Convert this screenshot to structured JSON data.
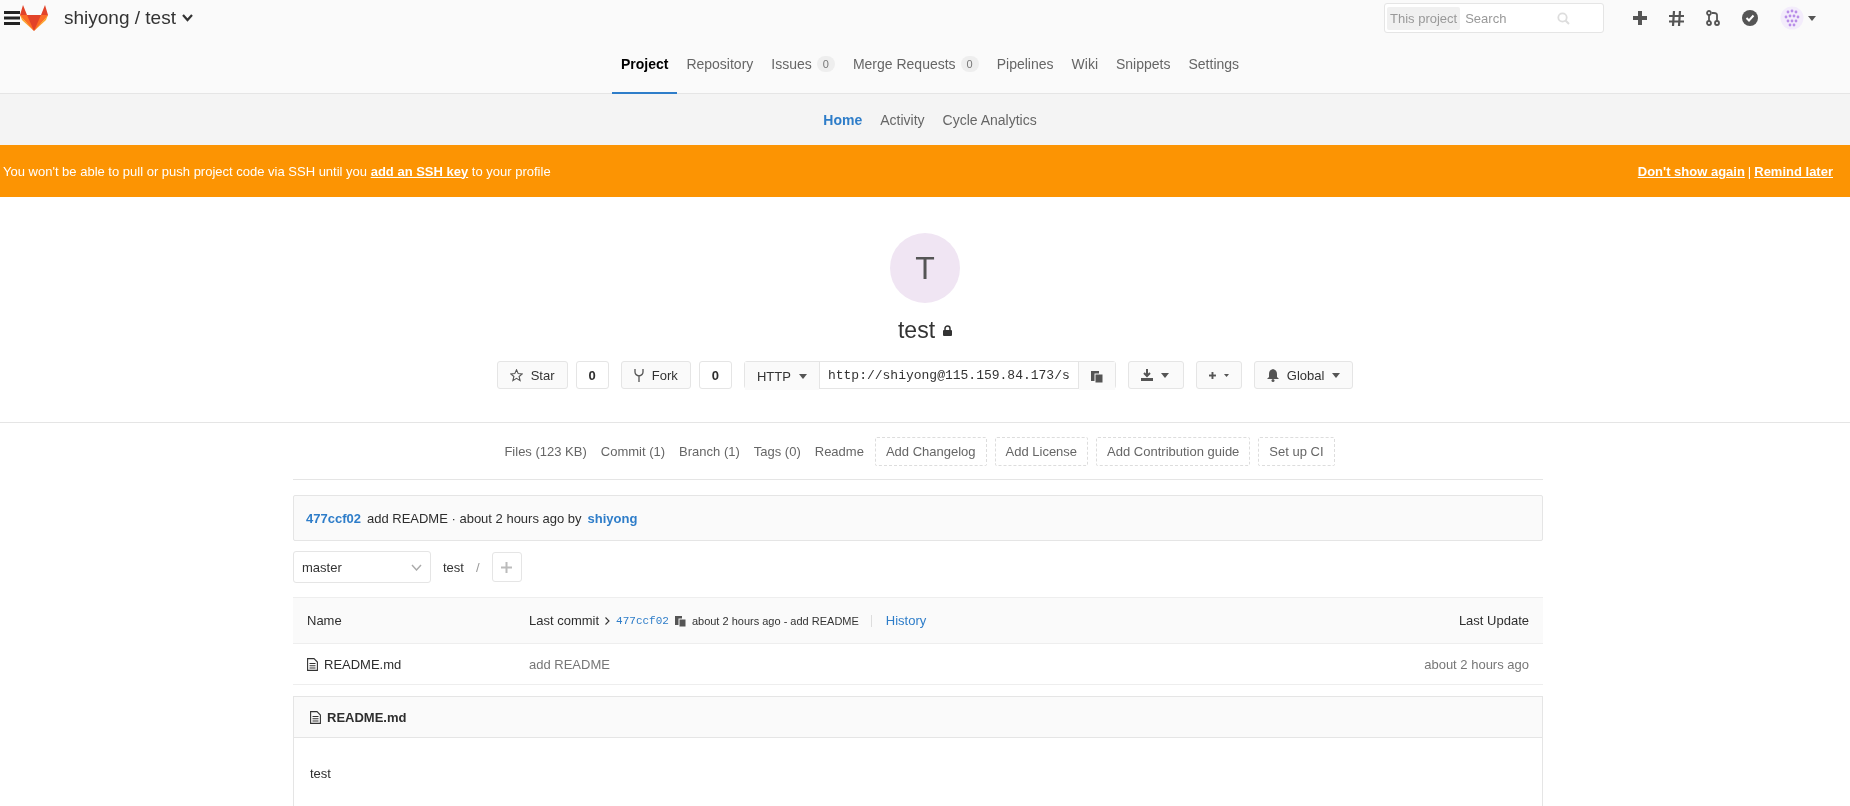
{
  "header": {
    "project_path": "shiyong / test",
    "search": {
      "scope": "This project",
      "placeholder": "Search"
    }
  },
  "nav_tabs": [
    {
      "label": "Project",
      "selected": true
    },
    {
      "label": "Repository",
      "selected": false
    },
    {
      "label": "Issues",
      "count": "0",
      "selected": false
    },
    {
      "label": "Merge Requests",
      "count": "0",
      "selected": false
    },
    {
      "label": "Pipelines",
      "selected": false
    },
    {
      "label": "Wiki",
      "selected": false
    },
    {
      "label": "Snippets",
      "selected": false
    },
    {
      "label": "Settings",
      "selected": false
    }
  ],
  "sub_tabs": [
    {
      "label": "Home",
      "selected": true
    },
    {
      "label": "Activity",
      "selected": false
    },
    {
      "label": "Cycle Analytics",
      "selected": false
    }
  ],
  "banner": {
    "text_before": "You won't be able to pull or push project code via SSH until you",
    "link": "add an SSH key",
    "text_after": "to your profile",
    "actions": [
      "Don't show again",
      "Remind later"
    ],
    "separator": "|"
  },
  "project": {
    "avatar_letter": "T",
    "name": "test",
    "private": true,
    "star": {
      "label": "Star",
      "count": "0"
    },
    "fork": {
      "label": "Fork",
      "count": "0"
    },
    "clone": {
      "protocol": "HTTP",
      "url": "http://shiyong@115.159.84.173/s"
    },
    "notification": "Global"
  },
  "stats_links": [
    {
      "label": "Files (123 KB)",
      "kind": "link"
    },
    {
      "label": "Commit (1)",
      "kind": "link"
    },
    {
      "label": "Branch (1)",
      "kind": "link"
    },
    {
      "label": "Tags (0)",
      "kind": "link"
    },
    {
      "label": "Readme",
      "kind": "link"
    },
    {
      "label": "Add Changelog",
      "kind": "dashed"
    },
    {
      "label": "Add License",
      "kind": "dashed"
    },
    {
      "label": "Add Contribution guide",
      "kind": "dashed"
    },
    {
      "label": "Set up CI",
      "kind": "dashed"
    }
  ],
  "last_commit": {
    "sha": "477ccf02",
    "message": "add README · about 2 hours ago by",
    "author": "shiyong"
  },
  "branch": "master",
  "breadcrumb": {
    "path": "test",
    "separator": "/"
  },
  "file_table": {
    "columns": [
      "Name",
      "Last commit",
      "Last Update"
    ],
    "commit_sha": "477ccf02",
    "commit_summary": "about 2 hours ago - add README",
    "history": "History",
    "rows": [
      {
        "name": "README.md",
        "message": "add README",
        "updated": "about 2 hours ago"
      }
    ]
  },
  "readme": {
    "title": "README.md",
    "body": "test"
  }
}
